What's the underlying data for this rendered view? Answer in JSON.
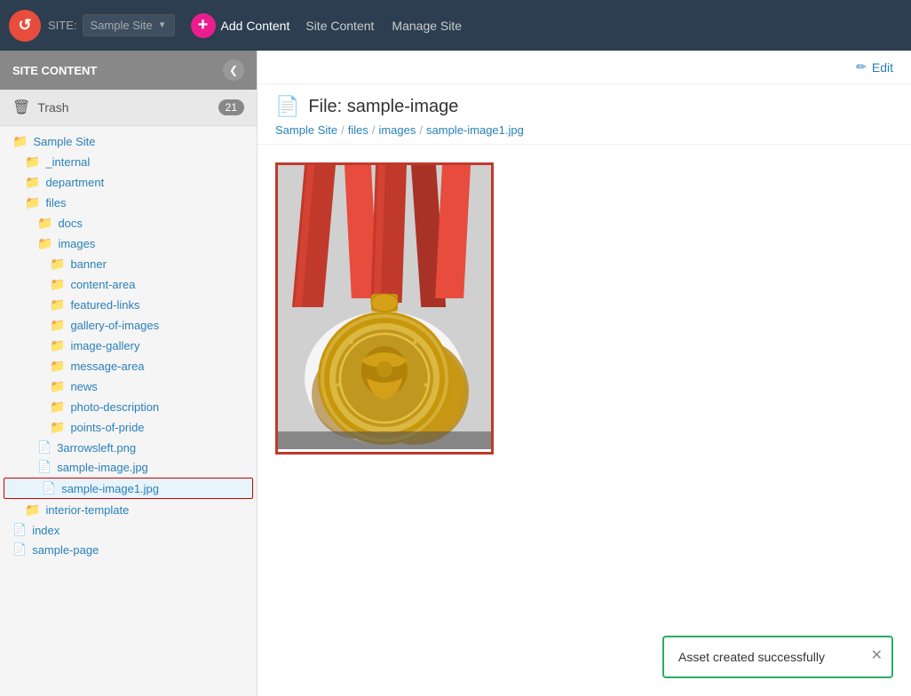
{
  "topNav": {
    "logo": "C",
    "siteLabel": "SITE:",
    "siteName": "Sample Site",
    "addContent": "Add Content",
    "siteContent": "Site Content",
    "manageSite": "Manage Site"
  },
  "sidebar": {
    "title": "SITE CONTENT",
    "trash": {
      "label": "Trash",
      "count": "21"
    },
    "tree": [
      {
        "label": "Sample Site",
        "type": "folder",
        "indent": 0
      },
      {
        "label": "_internal",
        "type": "folder",
        "indent": 1
      },
      {
        "label": "department",
        "type": "folder",
        "indent": 1
      },
      {
        "label": "files",
        "type": "folder",
        "indent": 1
      },
      {
        "label": "docs",
        "type": "folder",
        "indent": 2
      },
      {
        "label": "images",
        "type": "folder",
        "indent": 2
      },
      {
        "label": "banner",
        "type": "folder",
        "indent": 3
      },
      {
        "label": "content-area",
        "type": "folder",
        "indent": 3
      },
      {
        "label": "featured-links",
        "type": "folder",
        "indent": 3
      },
      {
        "label": "gallery-of-images",
        "type": "folder",
        "indent": 3
      },
      {
        "label": "image-gallery",
        "type": "folder",
        "indent": 3
      },
      {
        "label": "message-area",
        "type": "folder",
        "indent": 3
      },
      {
        "label": "news",
        "type": "folder",
        "indent": 3
      },
      {
        "label": "photo-description",
        "type": "folder",
        "indent": 3
      },
      {
        "label": "points-of-pride",
        "type": "folder",
        "indent": 3
      },
      {
        "label": "3arrowsleft.png",
        "type": "file",
        "indent": 2
      },
      {
        "label": "sample-image.jpg",
        "type": "file",
        "indent": 2
      },
      {
        "label": "sample-image1.jpg",
        "type": "file",
        "indent": 2,
        "selected": true
      },
      {
        "label": "interior-template",
        "type": "folder",
        "indent": 1
      },
      {
        "label": "index",
        "type": "file",
        "indent": 0
      },
      {
        "label": "sample-page",
        "type": "file",
        "indent": 0
      }
    ]
  },
  "content": {
    "editLabel": "Edit",
    "fileTitle": "File: sample-image",
    "breadcrumb": [
      "Sample Site",
      "files",
      "images",
      "sample-image1.jpg"
    ],
    "toast": "Asset created successfully"
  }
}
